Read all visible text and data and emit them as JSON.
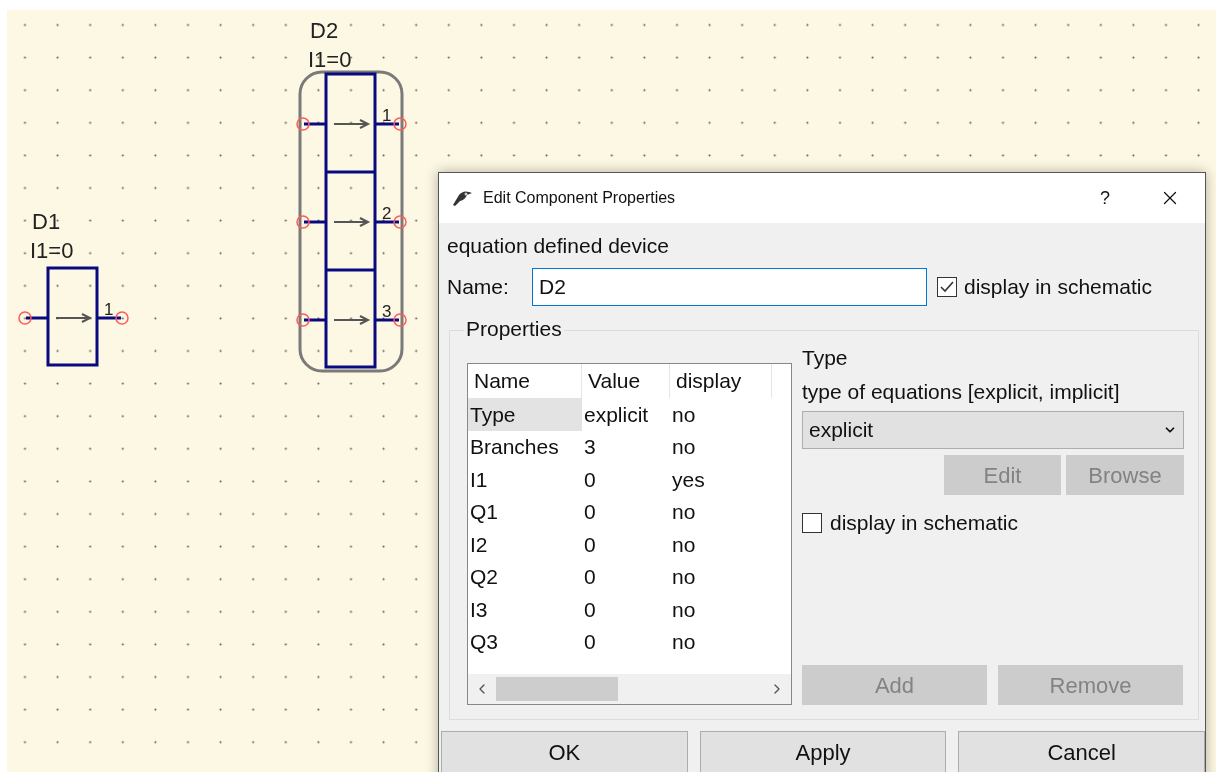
{
  "schematic": {
    "components": [
      {
        "name": "D1",
        "parameter": "I1=0",
        "selected": false,
        "branches": [
          "1"
        ]
      },
      {
        "name": "D2",
        "parameter": "I1=0",
        "selected": true,
        "branches": [
          "1",
          "2",
          "3"
        ]
      }
    ]
  },
  "dialog": {
    "title": "Edit Component Properties",
    "help_button": "?",
    "description": "equation defined device",
    "name_label": "Name:",
    "name_value": "D2",
    "display_in_schematic": {
      "label": "display in schematic",
      "checked": true
    },
    "properties": {
      "title": "Properties",
      "columns": [
        "Name",
        "Value",
        "display"
      ],
      "rows": [
        {
          "cells": [
            "Type",
            "explicit",
            "no"
          ],
          "selected": true
        },
        {
          "cells": [
            "Branches",
            "3",
            "no"
          ],
          "selected": false
        },
        {
          "cells": [
            "I1",
            "0",
            "yes"
          ],
          "selected": false
        },
        {
          "cells": [
            "Q1",
            "0",
            "no"
          ],
          "selected": false
        },
        {
          "cells": [
            "I2",
            "0",
            "no"
          ],
          "selected": false
        },
        {
          "cells": [
            "Q2",
            "0",
            "no"
          ],
          "selected": false
        },
        {
          "cells": [
            "I3",
            "0",
            "no"
          ],
          "selected": false
        },
        {
          "cells": [
            "Q3",
            "0",
            "no"
          ],
          "selected": false
        }
      ],
      "detail": {
        "title": "Type",
        "description": "type of equations [explicit, implicit]",
        "select_value": "explicit",
        "edit_button": {
          "label": "Edit",
          "disabled": true
        },
        "browse_button": {
          "label": "Browse",
          "disabled": true
        },
        "display_in_schematic": {
          "label": "display in schematic",
          "checked": false
        },
        "add_button": {
          "label": "Add",
          "disabled": true
        },
        "remove_button": {
          "label": "Remove",
          "disabled": true
        }
      }
    },
    "buttons": [
      "OK",
      "Apply",
      "Cancel"
    ]
  }
}
